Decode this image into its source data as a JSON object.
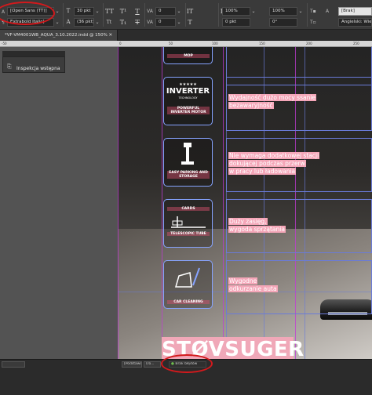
{
  "control_bar": {
    "font_family": "[Open Sans (TT)]",
    "font_style": "Extrabold Italic]",
    "font_size": "30 pkt",
    "leading": "(36 pkt)",
    "tracking": "0",
    "kerning": "0",
    "scale_h": "100%",
    "scale_v": "100%",
    "baseline": "0 pkt",
    "skew": "0°",
    "scale_h2": "100%",
    "char_style": "[Brak]",
    "language": "Angielski: Wielka"
  },
  "document_tab": {
    "title": "*VF-VM4001WB_AQUA_3.10.2022.indd @ 150%"
  },
  "ruler": {
    "marks": [
      "-50",
      "0",
      "50",
      "100",
      "150",
      "200",
      "250"
    ]
  },
  "panel": {
    "label": "Inspekcja wstępna"
  },
  "document": {
    "icons": [
      {
        "id": "top",
        "caption": "MOP"
      },
      {
        "id": "inverter",
        "stars": "★★★★★",
        "brand": "INVERTER",
        "brand_sub": "TECHNOLOGY",
        "caption": "POWERFUL INVERTER MOTOR"
      },
      {
        "id": "parking",
        "caption": "EASY PARKING AND STORAGE"
      },
      {
        "id": "telescopic",
        "caption": "TELESCOPIC TUBE",
        "caption_top": "CARDS"
      },
      {
        "id": "car",
        "caption": "CAR CLEANING"
      }
    ],
    "texts": [
      {
        "lines": [
          "Wydajność dużo mocy ssanie",
          "bezawaryjność"
        ]
      },
      {
        "lines": [
          "Nie wymaga dodatkowej stacji",
          "dokującej podczas przerw",
          "w pracy lub ładowania"
        ]
      },
      {
        "lines": [
          "Duży zasięg,",
          "wygoda sprzątania"
        ]
      },
      {
        "lines": [
          "Wygodne",
          "odkurzanie auta"
        ]
      }
    ],
    "title": "STØVSUGER"
  },
  "status_bar": {
    "style": "[Podstawowy]",
    "info": "(ro...",
    "errors": "Brak błędów"
  }
}
